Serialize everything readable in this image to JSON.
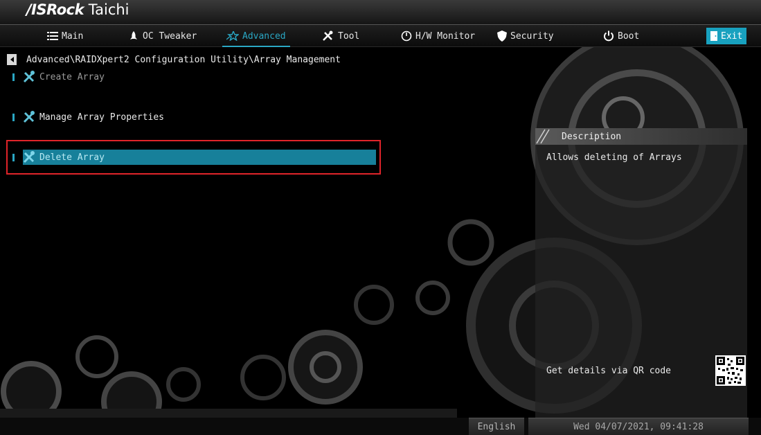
{
  "brand": {
    "name_part1": "/ISRock",
    "name_part2": "Taichi"
  },
  "nav": {
    "tabs": [
      {
        "label": "Main",
        "icon": "list-icon"
      },
      {
        "label": "OC Tweaker",
        "icon": "rocket-icon"
      },
      {
        "label": "Advanced",
        "icon": "star-icon",
        "active": true
      },
      {
        "label": "Tool",
        "icon": "tools-icon"
      },
      {
        "label": "H/W Monitor",
        "icon": "monitor-icon"
      },
      {
        "label": "Security",
        "icon": "shield-icon"
      },
      {
        "label": "Boot",
        "icon": "power-icon"
      },
      {
        "label": "Exit",
        "icon": "exit-door-icon"
      }
    ]
  },
  "breadcrumb": "Advanced\\RAIDXpert2 Configuration Utility\\Array Management",
  "menu": {
    "items": [
      {
        "label": "Create Array",
        "state": "disabled"
      },
      {
        "label": "Manage Array Properties",
        "state": "normal"
      },
      {
        "label": "Delete Array",
        "state": "selected"
      }
    ]
  },
  "description": {
    "title": "Description",
    "text": "Allows deleting of Arrays",
    "qr_hint": "Get details via QR code"
  },
  "footer": {
    "language": "English",
    "datetime": "Wed 04/07/2021, 09:41:28"
  },
  "colors": {
    "accent": "#2aa7c4",
    "selection": "#17809a",
    "highlight_box": "#e0242a"
  }
}
